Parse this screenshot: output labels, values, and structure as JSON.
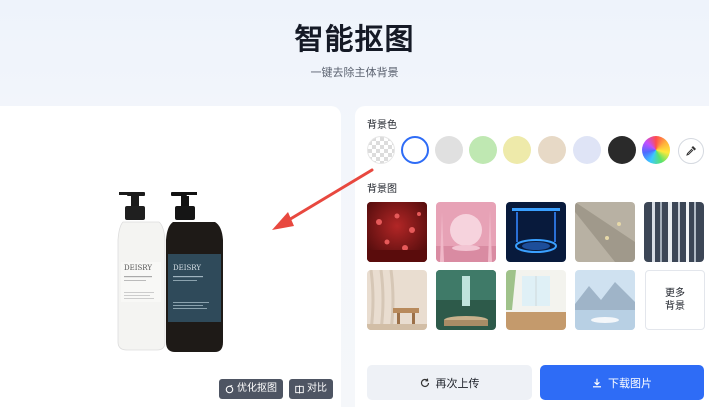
{
  "header": {
    "title": "智能抠图",
    "subtitle": "一键去除主体背景"
  },
  "preview": {
    "optimize_label": "优化抠图",
    "compare_label": "对比",
    "product_brand": "DEISRY"
  },
  "settings": {
    "bg_color_label": "背景色",
    "bg_image_label": "背景图",
    "swatches": [
      {
        "name": "transparent",
        "color": "transparent"
      },
      {
        "name": "white",
        "color": "#ffffff",
        "selected": true
      },
      {
        "name": "gray",
        "color": "#e0e0e0"
      },
      {
        "name": "green",
        "color": "#bfe8b2"
      },
      {
        "name": "yellow",
        "color": "#eeeaaa"
      },
      {
        "name": "beige",
        "color": "#e7d9c6"
      },
      {
        "name": "lavender",
        "color": "#dfe4f6"
      },
      {
        "name": "black",
        "color": "#2a2a2a"
      },
      {
        "name": "rainbow",
        "color": "conic"
      }
    ],
    "more_bg_line1": "更多",
    "more_bg_line2": "背景",
    "reupload_label": "再次上传",
    "download_label": "下载图片"
  },
  "colors": {
    "accent": "#2e6cf6",
    "arrow": "#e8483f",
    "tool_button_bg": "#4e5563"
  },
  "icons": [
    "optimize-icon",
    "compare-icon",
    "eyedropper-icon",
    "refresh-icon",
    "download-icon"
  ]
}
